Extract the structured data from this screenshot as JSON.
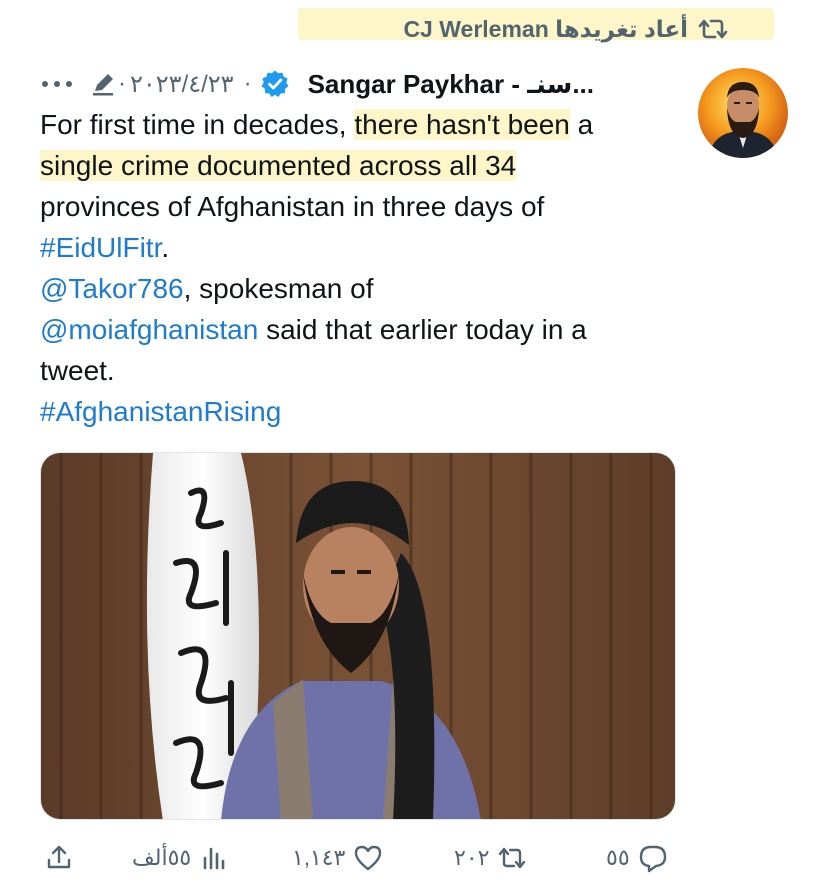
{
  "retweet": {
    "icon": "retweet-icon",
    "text": "أعاد تغريدها CJ Werleman",
    "highlight_color": "#fdf6c9"
  },
  "tweet": {
    "author_name": "Sangar Paykhar - سنـ...",
    "verified_icon": "verified-badge-icon",
    "date": "٢٠٢٣/٤/٢٣",
    "edited_icon": "pencil-icon",
    "more_icon": "more-icon",
    "lines": {
      "l1a": "For first time in decades, ",
      "l1b": "there hasn't been",
      "l1c": " a",
      "l2a": "single crime documented across all 34",
      "l3": "provinces of Afghanistan in three days of",
      "l4link": "#EidUlFitr",
      "l4rest": ".",
      "l5link": "@Takor786",
      "l5rest": ", spokesman of",
      "l6link": "@moiafghanistan",
      "l6rest": " said that earlier today in a",
      "l7": "tweet.",
      "l8link": "#AfghanistanRising"
    },
    "link_color": "#1d7bd1"
  },
  "actions": {
    "reply_count": "٥٥",
    "retweet_count": "٢٠٢",
    "like_count": "١,١٤٣",
    "views_count": "٥٥ألف"
  }
}
